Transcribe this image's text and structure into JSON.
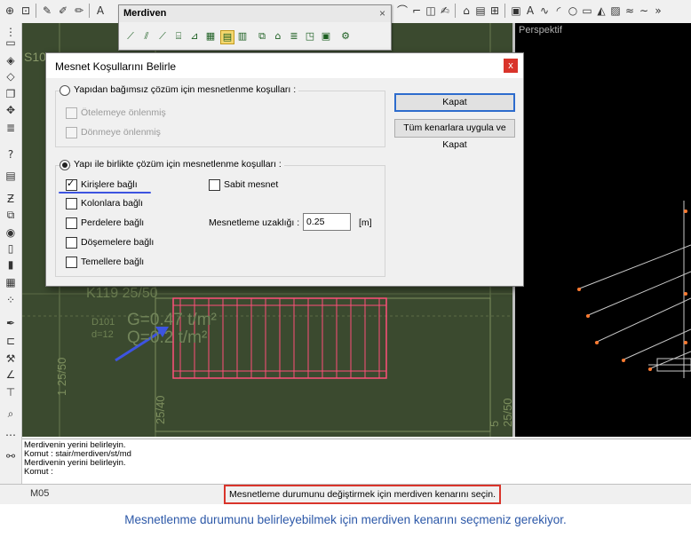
{
  "toolbar_floating": {
    "title": "Merdiven",
    "close_glyph": "×"
  },
  "perspective": {
    "label": "Perspektif"
  },
  "plan": {
    "beam_label": "K119 25/50",
    "slab_id": "D101",
    "slab_thickness": "d=12",
    "load_g": "G=0.47 t/m²",
    "load_q": "Q=0.2 t/m²",
    "col_left": "1 25/50",
    "col_mid": "25/40",
    "col_right": "5 25/50",
    "partial_label": "S10"
  },
  "dialog": {
    "title": "Mesnet Koşullarını Belirle",
    "close_glyph": "x",
    "group1": {
      "label": "Yapıdan bağımsız çözüm için mesnetlenme koşulları :",
      "selected": false,
      "options": [
        {
          "label": "Ötelemeye önlenmiş",
          "checked": false,
          "enabled": false
        },
        {
          "label": "Dönmeye önlenmiş",
          "checked": false,
          "enabled": false
        }
      ]
    },
    "group2": {
      "label": "Yapı ile birlikte çözüm için mesnetlenme koşulları :",
      "selected": true,
      "options": [
        {
          "label": "Kirişlere bağlı",
          "checked": true
        },
        {
          "label": "Kolonlara bağlı",
          "checked": false
        },
        {
          "label": "Perdelere bağlı",
          "checked": false
        },
        {
          "label": "Döşemelere bağlı",
          "checked": false
        },
        {
          "label": "Temellere bağlı",
          "checked": false
        }
      ],
      "fixed_support": {
        "label": "Sabit mesnet",
        "checked": false
      },
      "distance": {
        "label": "Mesnetleme uzaklığı :",
        "value": "0.25",
        "unit": "[m]"
      }
    },
    "buttons": {
      "close": "Kapat",
      "apply_all": "Tüm kenarlara uygula ve Kapat"
    }
  },
  "command": {
    "lines": [
      "Merdivenin yerini belirleyin.",
      "Komut : stair/merdiven/st/md",
      "Merdivenin yerini belirleyin.",
      "Komut :"
    ]
  },
  "status": {
    "layer": "M05",
    "message": "Mesnetleme durumunu değiştirmek için merdiven kenarını seçin."
  },
  "note": "Mesnetlenme durumunu belirleyebilmek için merdiven kenarını seçmeniz gerekiyor.",
  "colors": {
    "accent_red": "#d9342b",
    "annotation_blue": "#2c58a8",
    "stair_pink": "#ff4f7a",
    "plan_bg": "#3b4a2f"
  }
}
